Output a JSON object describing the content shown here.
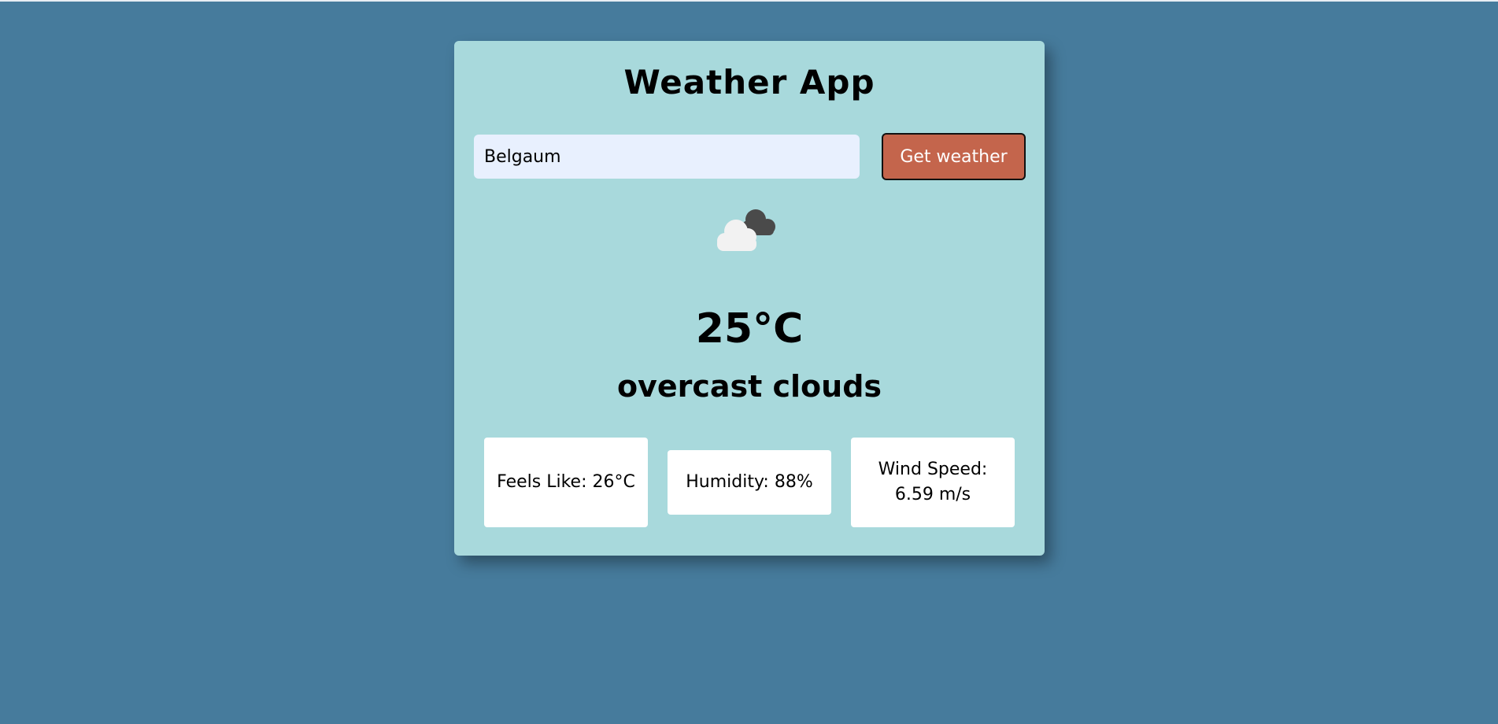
{
  "app": {
    "title": "Weather App"
  },
  "search": {
    "value": "Belgaum",
    "button_label": "Get weather"
  },
  "weather": {
    "icon": "overcast-clouds-icon",
    "temperature": "25°C",
    "description": "overcast clouds"
  },
  "details": {
    "feels_like": "Feels Like: 26°C",
    "humidity": "Humidity: 88%",
    "wind_speed": "Wind Speed: 6.59 m/s"
  },
  "colors": {
    "background": "#467b9c",
    "card": "#a8d9dc",
    "button": "#c4654c",
    "input": "#e8f0fe"
  }
}
